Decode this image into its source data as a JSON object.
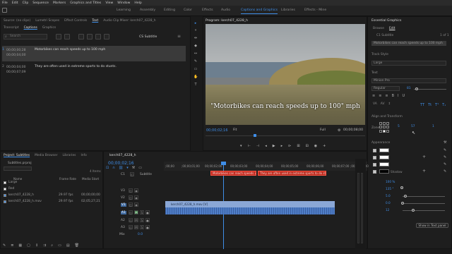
{
  "menu": [
    "File",
    "Edit",
    "Clip",
    "Sequence",
    "Markers",
    "Graphics and Titles",
    "View",
    "Window",
    "Help"
  ],
  "workspaces": [
    {
      "label": "Learning",
      "active": false
    },
    {
      "label": "Assembly",
      "active": false
    },
    {
      "label": "Editing",
      "active": false
    },
    {
      "label": "Color",
      "active": false
    },
    {
      "label": "Effects",
      "active": false
    },
    {
      "label": "Audio",
      "active": false
    },
    {
      "label": "Captions and Graphics",
      "active": true
    },
    {
      "label": "Libraries",
      "active": false
    },
    {
      "label": "Effects - Mine",
      "active": false
    }
  ],
  "text_panel": {
    "top_tabs": [
      "Source: (no clips)",
      "Lumetri Scopes",
      "Effect Controls",
      "Text",
      "Audio Clip Mixer: kerch07_4228_h"
    ],
    "sub_tabs": [
      "Transcript",
      "Captions",
      "Graphics"
    ],
    "search_placeholder": "Search",
    "track_label": "CS Subtitle",
    "captions": [
      {
        "num": "1",
        "in": "00;00;00;28",
        "out": "00;00;04;00",
        "text": "Motorbikes can reach speeds up to 100 mph",
        "selected": true
      },
      {
        "num": "2",
        "in": "00;00;04;00",
        "out": "00;00;07;09",
        "text": "They are often used in extreme sports to do stunts.",
        "selected": false
      }
    ]
  },
  "program": {
    "title": "Program: kerch07_4228_h",
    "subtitle_text": "\"Motorbikes can reach speeds up to 100\" mph",
    "timecode": "00;00;02;16",
    "fit": "Fit",
    "quality": "Full",
    "duration": "00;00;08;00"
  },
  "essential_graphics": {
    "tabs": [
      "Browse",
      "Edit"
    ],
    "header": "C1 Subtitle",
    "page": "1 of 1",
    "text_layer": "Motorbikes can reach speeds up to 100 mph",
    "track_style_label": "Track Style",
    "track_style": "Large",
    "text_label": "Text",
    "font": "Minion Pro",
    "font_style": "Regular",
    "font_size": "81",
    "align_label": "Align and Transform",
    "zone_label": "Zone",
    "x_val": "5",
    "y_val": "57",
    "z_val": "1",
    "appearance_label": "Appearance",
    "shadow_label": "Shadow",
    "opacity": "100 %",
    "angle": "135 °",
    "distance": "5.0",
    "size": "0.0",
    "blur": "12",
    "show_button": "Show in Text panel",
    "colors": {
      "fill": "#ffffff",
      "stroke": "#ffffff",
      "background": "#ffffff",
      "shadow": "#000000"
    }
  },
  "project": {
    "tabs": [
      "Project: Subtitles",
      "Media Browser",
      "Libraries",
      "Info"
    ],
    "file": "Subtitles.prproj",
    "count": "4 Items",
    "col_name": "Name",
    "col_rate": "Frame Rate",
    "col_start": "Media Start",
    "items": [
      {
        "name": "Large",
        "rate": "",
        "start": "",
        "color": "#ffffff"
      },
      {
        "name": "Red",
        "rate": "",
        "start": "",
        "color": "#ffffff"
      },
      {
        "name": "kerch07_4228_h",
        "rate": "29.97 fps",
        "start": "00;00;00;00",
        "color": "#3f8ee8"
      },
      {
        "name": "kerch07_4228_h.mov",
        "rate": "29.97 fps",
        "start": "02;05;27;21",
        "color": "#3f8ee8"
      }
    ]
  },
  "timeline": {
    "tab": "kerch07_4228_h",
    "timecode": "00;00;02;16",
    "ruler": [
      ";00;00",
      ";00;00;01;00",
      "00;00;02;00",
      "00;00;03;00",
      "00;00;04;00",
      "00;00;05;00",
      "00;00;06;00",
      "00;00;07;00",
      ";00;00;08;00"
    ],
    "caption_track": "Subtitle",
    "tracks": [
      "C1",
      "V3",
      "V2",
      "V1",
      "A1",
      "A2",
      "A3",
      "Mix"
    ],
    "mix_value": "0.0",
    "video_clip": "kerch07_4228_h.mov [V]",
    "caption_clips": [
      "Motorbikes can reach speeds up to 100 mph",
      "They are often used in extreme sports to do stunts."
    ]
  }
}
